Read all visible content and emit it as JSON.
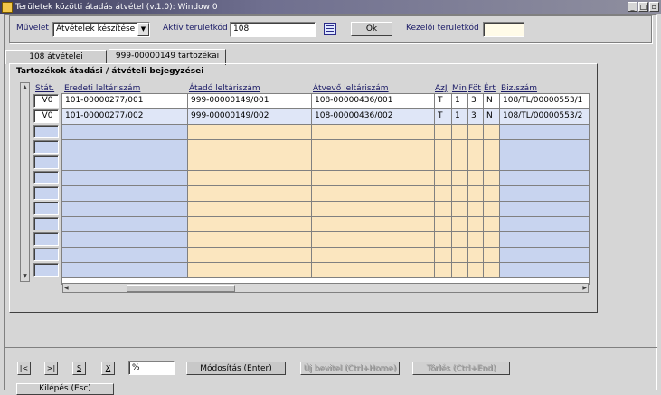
{
  "window": {
    "title": "Területek közötti átadás átvétel (v.1.0): Window 0"
  },
  "top": {
    "muvelet_label": "Művelet",
    "muvelet_value": "Átvételek készítése",
    "aktiv_label": "Aktív területkód",
    "aktiv_value": "108",
    "ok_label": "Ok",
    "kezeloi_label": "Kezelői területkód",
    "kezeloi_value": ""
  },
  "tabs": [
    {
      "label": "108 átvételei"
    },
    {
      "label": "999-00000149 tartozékai"
    }
  ],
  "panel": {
    "title": "Tartozékok átadási / átvételi bejegyzései",
    "columns": [
      "Stát.",
      "Eredeti leltáriszám",
      "Átadó leltáriszám",
      "Átvevő leltáriszám",
      "AzJ",
      "Min",
      "Föt",
      "Ért",
      "Biz.szám"
    ],
    "rows": [
      {
        "stat": "V0",
        "eredeti": "101-00000277/001",
        "atado": "999-00000149/001",
        "atvevo": "108-00000436/001",
        "azj": "T",
        "min": "1",
        "fot": "3",
        "ert": "N",
        "biz": "108/TL/00000553/1"
      },
      {
        "stat": "V0",
        "eredeti": "101-00000277/002",
        "atado": "999-00000149/002",
        "atvevo": "108-00000436/002",
        "azj": "T",
        "min": "1",
        "fot": "3",
        "ert": "N",
        "biz": "108/TL/00000553/2"
      }
    ]
  },
  "bottom": {
    "nav_first": "|<",
    "nav_last": ">|",
    "nav_s": "S",
    "nav_x": "X",
    "search_value": "%",
    "modositas": "Módosítás (Enter)",
    "uj_bevitel": "Új bevitel (Ctrl+Home)",
    "torles": "Törlés (Ctrl+End)",
    "kilepes": "Kilépés (Esc)"
  }
}
